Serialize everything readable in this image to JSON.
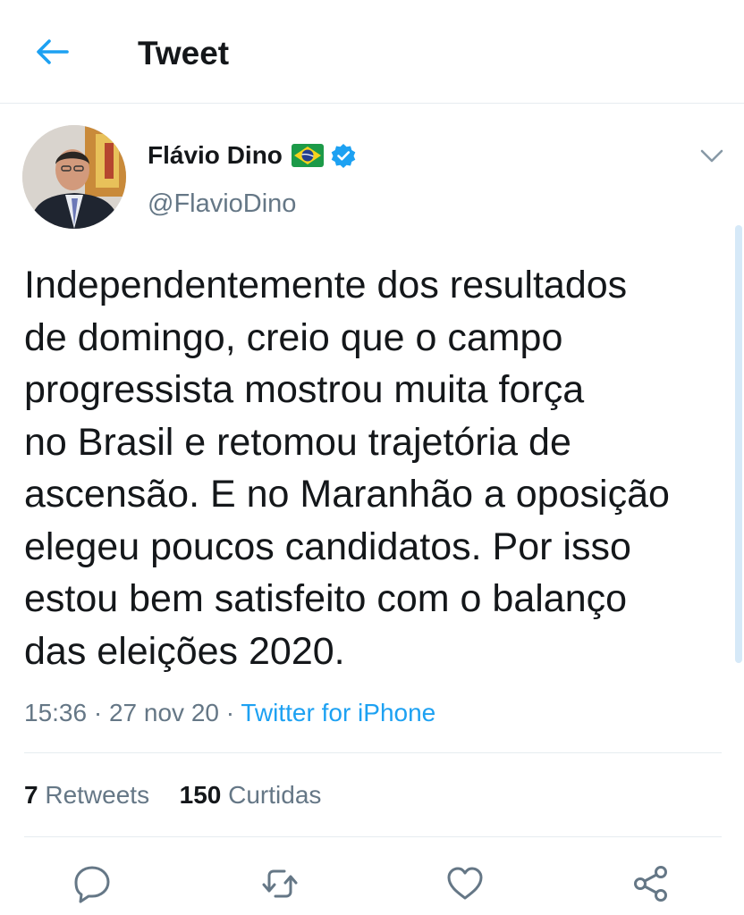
{
  "header": {
    "title": "Tweet",
    "back_icon": "arrow-left-icon"
  },
  "author": {
    "name": "Flávio Dino",
    "handle": "@FlavioDino",
    "flag_icon": "brazil-flag-icon",
    "verified_icon": "verified-badge-icon"
  },
  "tweet": {
    "lines": [
      "Independentemente dos resultados",
      "de domingo, creio que o campo",
      "progressista mostrou muita força",
      "no Brasil e retomou trajetória de",
      "ascensão. E no Maranhão a oposição",
      "elegeu poucos candidatos. Por isso",
      "estou bem satisfeito com o balanço",
      "das eleições 2020."
    ],
    "time": "15:36",
    "separator": "·",
    "date": "27 nov 20",
    "source": "Twitter for iPhone"
  },
  "stats": {
    "retweets_count": "7",
    "retweets_label": "Retweets",
    "likes_count": "150",
    "likes_label": "Curtidas"
  },
  "actions": [
    "reply-icon",
    "retweet-icon",
    "like-icon",
    "share-icon"
  ],
  "colors": {
    "accent": "#1da1f2",
    "text": "#14171a",
    "secondary_text": "#657786",
    "divider": "#e6ecf0"
  }
}
